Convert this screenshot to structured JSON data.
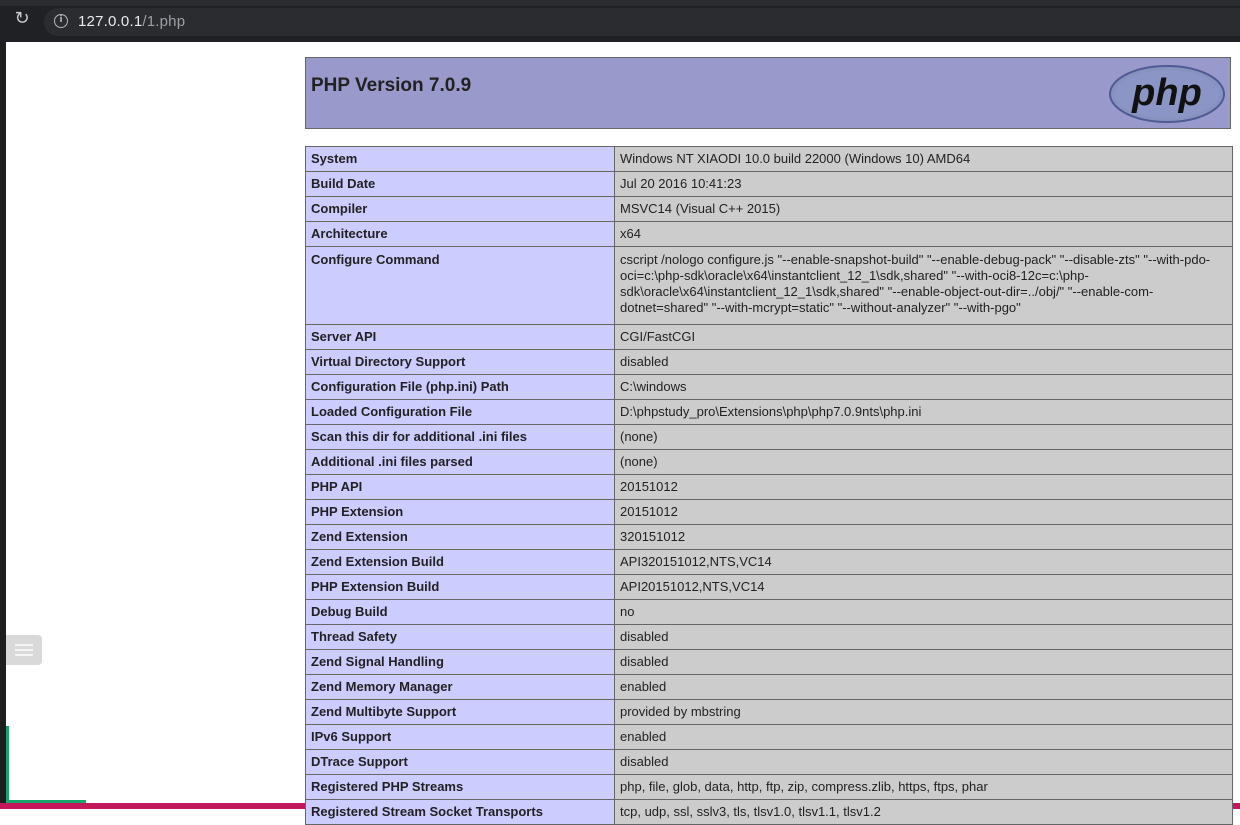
{
  "browser": {
    "url_host": "127.0.0.1",
    "url_path": "/1.php",
    "reload_icon": "reload-icon",
    "info_icon": "info-icon"
  },
  "header": {
    "title": "PHP Version 7.0.9",
    "logo_text": "php",
    "bg_color": "#9999cc"
  },
  "rows": [
    {
      "label": "System",
      "value": "Windows NT XIAODI 10.0 build 22000 (Windows 10) AMD64"
    },
    {
      "label": "Build Date",
      "value": "Jul 20 2016 10:41:23"
    },
    {
      "label": "Compiler",
      "value": "MSVC14 (Visual C++ 2015)"
    },
    {
      "label": "Architecture",
      "value": "x64"
    },
    {
      "label": "Configure Command",
      "value": "cscript /nologo configure.js \"--enable-snapshot-build\" \"--enable-debug-pack\" \"--disable-zts\" \"--with-pdo-oci=c:\\php-sdk\\oracle\\x64\\instantclient_12_1\\sdk,shared\" \"--with-oci8-12c=c:\\php-sdk\\oracle\\x64\\instantclient_12_1\\sdk,shared\" \"--enable-object-out-dir=../obj/\" \"--enable-com-dotnet=shared\" \"--with-mcrypt=static\" \"--without-analyzer\" \"--with-pgo\""
    },
    {
      "label": "Server API",
      "value": "CGI/FastCGI"
    },
    {
      "label": "Virtual Directory Support",
      "value": "disabled"
    },
    {
      "label": "Configuration File (php.ini) Path",
      "value": "C:\\windows"
    },
    {
      "label": "Loaded Configuration File",
      "value": "D:\\phpstudy_pro\\Extensions\\php\\php7.0.9nts\\php.ini"
    },
    {
      "label": "Scan this dir for additional .ini files",
      "value": "(none)"
    },
    {
      "label": "Additional .ini files parsed",
      "value": "(none)"
    },
    {
      "label": "PHP API",
      "value": "20151012"
    },
    {
      "label": "PHP Extension",
      "value": "20151012"
    },
    {
      "label": "Zend Extension",
      "value": "320151012"
    },
    {
      "label": "Zend Extension Build",
      "value": "API320151012,NTS,VC14"
    },
    {
      "label": "PHP Extension Build",
      "value": "API20151012,NTS,VC14"
    },
    {
      "label": "Debug Build",
      "value": "no"
    },
    {
      "label": "Thread Safety",
      "value": "disabled"
    },
    {
      "label": "Zend Signal Handling",
      "value": "disabled"
    },
    {
      "label": "Zend Memory Manager",
      "value": "enabled"
    },
    {
      "label": "Zend Multibyte Support",
      "value": "provided by mbstring"
    },
    {
      "label": "IPv6 Support",
      "value": "enabled"
    },
    {
      "label": "DTrace Support",
      "value": "disabled"
    },
    {
      "label": "Registered PHP Streams",
      "value": "php, file, glob, data, http, ftp, zip, compress.zlib, https, ftps, phar"
    },
    {
      "label": "Registered Stream Socket Transports",
      "value": "tcp, udp, ssl, sslv3, tls, tlsv1.0, tlsv1.1, tlsv1.2"
    }
  ],
  "side_toc_icon": "list-icon"
}
